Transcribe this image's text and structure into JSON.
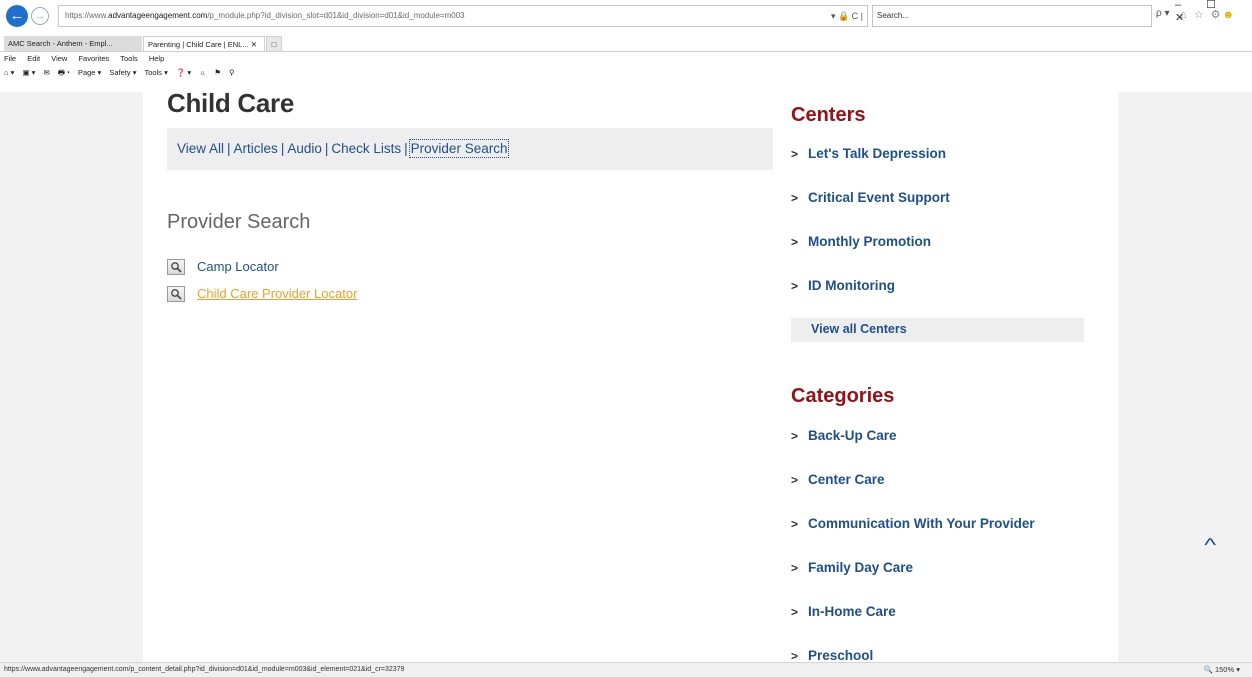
{
  "browser": {
    "url_prefix": "https://www.",
    "url_host": "advantageengagement.com",
    "url_path": "/p_module.php?id_division_slot=d01&id_division=d01&id_module=m003",
    "url_tools": "▾ 🔒 C |",
    "search_placeholder": "Search...",
    "search_go": "ρ ▾",
    "right_icons": "⌂ ☆ ⚙",
    "smiley": "☻",
    "window_controls": "– ☐ ✕",
    "tabs": [
      {
        "label": "AMC Search - Anthem - Empl..."
      },
      {
        "label": "Parenting | Child Care | ENL... ✕"
      }
    ],
    "menu": [
      "File",
      "Edit",
      "View",
      "Favorites",
      "Tools",
      "Help"
    ],
    "commands": [
      "⌂ ▾",
      "▣ ▾",
      "✉",
      "🖶 ▾",
      "Page ▾",
      "Safety ▾",
      "Tools ▾",
      "❓ ▾",
      "☼",
      "⚑",
      "⚲"
    ]
  },
  "page": {
    "title": "Child Care",
    "subnav": {
      "view_all": "View All",
      "articles": "Articles",
      "audio": "Audio",
      "check_lists": "Check Lists",
      "provider_search": "Provider Search",
      "sep": "|"
    },
    "section_heading": "Provider Search",
    "locators": [
      {
        "label": "Camp Locator"
      },
      {
        "label": "Child Care Provider Locator"
      }
    ]
  },
  "sidebar": {
    "centers_heading": "Centers",
    "centers": [
      {
        "label": "Let's Talk Depression"
      },
      {
        "label": "Critical Event Support"
      },
      {
        "label": "Monthly Promotion"
      },
      {
        "label": "ID Monitoring"
      }
    ],
    "view_all_centers": "View all Centers",
    "categories_heading": "Categories",
    "categories": [
      {
        "label": "Back-Up Care"
      },
      {
        "label": "Center Care"
      },
      {
        "label": "Communication With Your Provider"
      },
      {
        "label": "Family Day Care"
      },
      {
        "label": "In-Home Care"
      },
      {
        "label": "Preschool"
      }
    ],
    "chevron": ">"
  },
  "status": {
    "url": "https://www.advantageengagement.com/p_content_detail.php?id_division=d01&id_module=m003&id_element=021&id_cr=32379",
    "zoom": "🔍 150%  ▾"
  },
  "scroll_top_icon": "^"
}
